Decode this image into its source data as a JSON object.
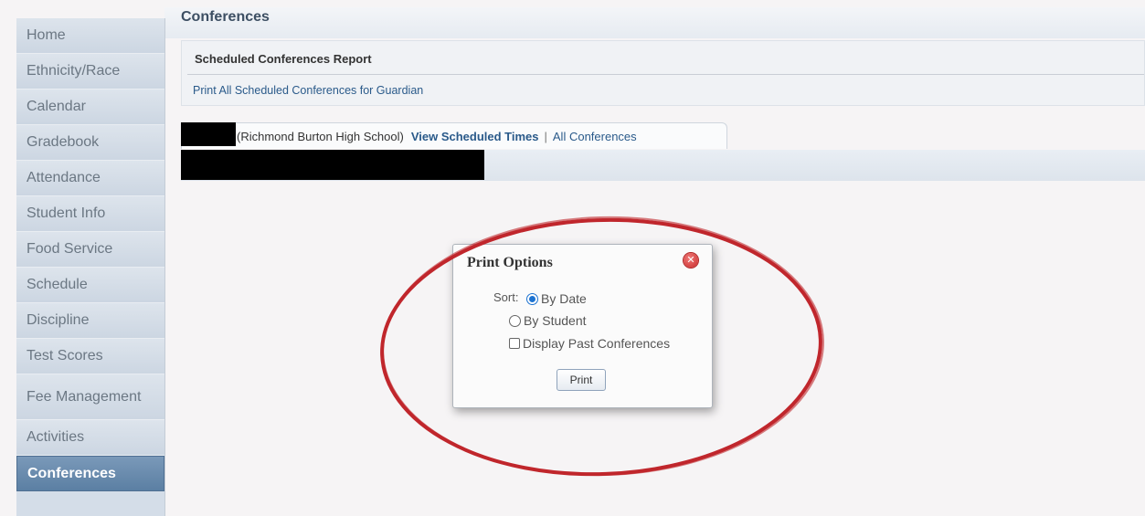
{
  "sidebar": {
    "items": [
      {
        "label": "Home"
      },
      {
        "label": "Ethnicity/Race"
      },
      {
        "label": "Calendar"
      },
      {
        "label": "Gradebook"
      },
      {
        "label": "Attendance"
      },
      {
        "label": "Student Info"
      },
      {
        "label": "Food Service"
      },
      {
        "label": "Schedule"
      },
      {
        "label": "Discipline"
      },
      {
        "label": "Test Scores"
      },
      {
        "label": "Fee Management"
      },
      {
        "label": "Activities"
      },
      {
        "label": "Conferences"
      }
    ],
    "active": "Conferences"
  },
  "page": {
    "title": "Conferences"
  },
  "report": {
    "header": "Scheduled Conferences Report",
    "print_all_link": "Print All Scheduled Conferences for Guardian"
  },
  "tab": {
    "school": "(Richmond Burton High School)",
    "view_link": "View Scheduled Times",
    "separator": "|",
    "all_link": "All Conferences"
  },
  "dialog": {
    "title": "Print Options",
    "sort_label": "Sort:",
    "options": {
      "by_date": "By Date",
      "by_student": "By Student"
    },
    "selected_sort": "By Date",
    "display_past_label": "Display Past Conferences",
    "display_past_checked": false,
    "print_button": "Print"
  },
  "colors": {
    "active_nav": "#5b7fa3",
    "link": "#2a5a8a",
    "annotation_ellipse": "#c0262c",
    "close_button": "#d9413f"
  }
}
